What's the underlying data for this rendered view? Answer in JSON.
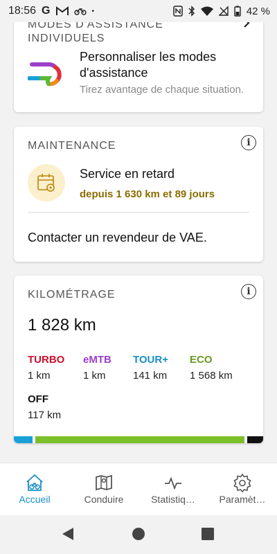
{
  "status_bar": {
    "time": "18:56",
    "g_label": "G",
    "dot": "•",
    "battery_pct": "42 %"
  },
  "cards": {
    "modes": {
      "title": "MODES D'ASSISTANCE INDIVIDUELS",
      "heading": "Personnaliser les modes d'assistance",
      "subtitle": "Tirez avantage de chaque situation."
    },
    "maintenance": {
      "title": "MAINTENANCE",
      "heading": "Service en retard",
      "subtitle": "depuis 1 630 km et 89 jours",
      "contact": "Contacter un revendeur de VAE."
    },
    "mileage": {
      "title": "KILOMÉTRAGE",
      "total": "1 828 km",
      "modes": [
        {
          "name": "TURBO",
          "value": "1 km",
          "color": "#c8102e"
        },
        {
          "name": "eMTB",
          "value": "1 km",
          "color": "#9b3fc9"
        },
        {
          "name": "TOUR+",
          "value": "141 km",
          "color": "#1a8ec8"
        },
        {
          "name": "ECO",
          "value": "1 568 km",
          "color": "#6a9a1f"
        },
        {
          "name": "OFF",
          "value": "117 km",
          "color": "#111111"
        }
      ],
      "bar": [
        {
          "mode": "TOUR+",
          "color": "#1aa0d8",
          "km": 141
        },
        {
          "mode": "ECO",
          "color": "#7bbf2a",
          "km": 1568
        },
        {
          "mode": "OFF",
          "color": "#111111",
          "km": 117
        }
      ]
    }
  },
  "nav": {
    "items": [
      {
        "label": "Accueil",
        "icon": "bike-home-icon",
        "active": true
      },
      {
        "label": "Conduire",
        "icon": "map-icon",
        "active": false
      },
      {
        "label": "Statistiq…",
        "icon": "activity-icon",
        "active": false
      },
      {
        "label": "Paramèt…",
        "icon": "gear-icon",
        "active": false
      }
    ]
  },
  "colors": {
    "accent": "#1a8ec8",
    "maintenance_warning": "#8a6d00"
  }
}
